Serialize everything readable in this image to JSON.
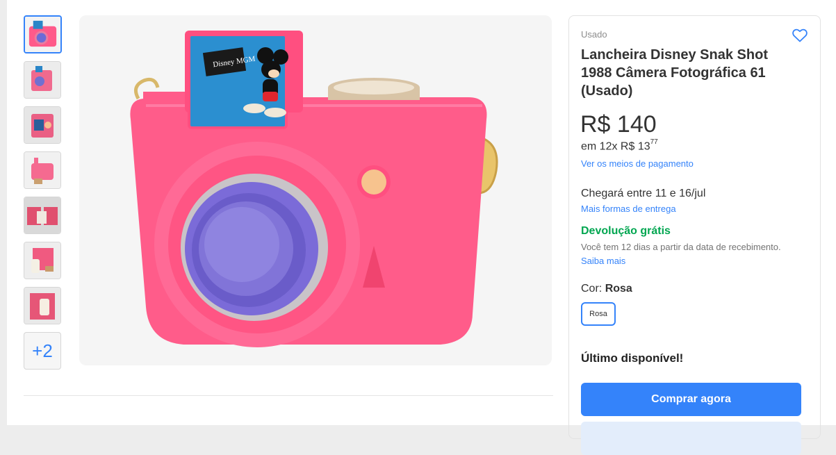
{
  "product": {
    "condition": "Usado",
    "title": "Lancheira Disney Snak Shot 1988 Câmera Fotográfica 61 (Usado)",
    "price": "R$ 140",
    "installments_prefix": "em 12x R$ 13",
    "installments_cents": "77",
    "payment_link": "Ver os meios de pagamento",
    "delivery": "Chegará entre 11 e 16/jul",
    "delivery_link": "Mais formas de entrega",
    "returns_title": "Devolução grátis",
    "returns_text": "Você tem 12 dias a partir da data de recebimento.",
    "returns_link": "Saiba mais",
    "color_label": "Cor:",
    "color_value": "Rosa",
    "color_option": "Rosa",
    "stock": "Último disponível!",
    "buy_button": "Comprar agora"
  },
  "gallery": {
    "more_count": "+2",
    "image_sign_text": "Disney MGM"
  },
  "icons": {
    "favorite": "heart-icon"
  },
  "colors": {
    "accent": "#3483fa",
    "success": "#00a650",
    "product_pink": "#ff5a8a"
  }
}
